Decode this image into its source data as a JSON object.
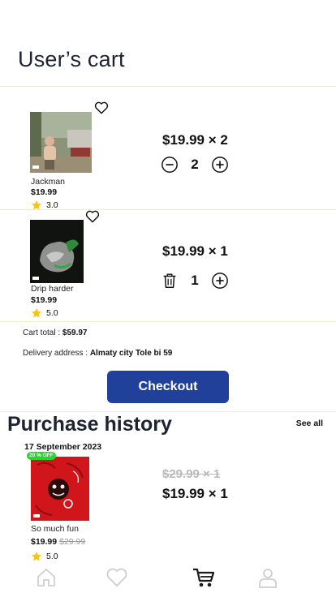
{
  "header": {
    "title": "User’s cart"
  },
  "cart": {
    "items": [
      {
        "name": "Jackman",
        "price": "$19.99",
        "rating": "3.0",
        "line_total": "$19.99 × 2",
        "quantity": "2",
        "decrement_icon": "minus-circle-icon",
        "favorite_icon": "heart-outline-icon"
      },
      {
        "name": "Drip harder",
        "price": "$19.99",
        "rating": "5.0",
        "line_total": "$19.99 × 1",
        "quantity": "1",
        "decrement_icon": "trash-icon",
        "favorite_icon": "heart-outline-icon"
      }
    ],
    "total_label": "Cart total : ",
    "total_value": "$59.97",
    "address_label": "Delivery address : ",
    "address_value": "Almaty city Tole bi 59",
    "checkout_label": "Checkout"
  },
  "history": {
    "title": "Purchase history",
    "see_all_label": "See all",
    "orders": [
      {
        "date": "17 September 2023",
        "badge": "20 % OFF",
        "name": "So much fun",
        "price": "$19.99",
        "old_price": "$29.99",
        "rating": "5.0",
        "old_line": "$29.99 × 1",
        "new_line": "$19.99 × 1"
      }
    ]
  },
  "nav": {
    "items": [
      {
        "icon": "home-icon",
        "active": false
      },
      {
        "icon": "heart-icon",
        "active": false
      },
      {
        "icon": "cart-icon",
        "active": true
      },
      {
        "icon": "profile-icon",
        "active": false
      }
    ]
  },
  "colors": {
    "accent": "#21409a",
    "star": "#f5c518",
    "badge": "#27d62e",
    "divider": "#f1ecd4",
    "nav_inactive": "#cfcfcf",
    "nav_active": "#1a1a1a"
  }
}
